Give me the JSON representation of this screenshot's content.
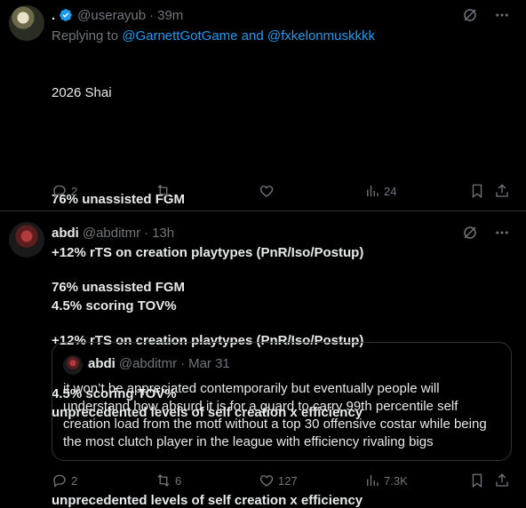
{
  "tweets": [
    {
      "name": ".",
      "handle": "@userayub",
      "time": "39m",
      "reply_prefix": "Replying to",
      "reply_user1": "@GarnettGotGame",
      "reply_and": "and",
      "reply_user2": "@fxkelonmuskkkk",
      "lines": [
        "2026 Shai",
        "",
        "76% unassisted FGM",
        "+12% rTS on creation playtypes (PnR/Iso/Postup)",
        "4.5% scoring TOV%",
        "",
        "unprecedented levels of self creation x efficiency"
      ],
      "actions": {
        "replies": "2",
        "retweets": "",
        "likes": "",
        "views": "24"
      }
    },
    {
      "name": "abdi",
      "handle": "@abditmr",
      "time": "13h",
      "lines": [
        "76% unassisted FGM",
        "+12% rTS on creation playtypes (PnR/Iso/Postup)",
        "4.5% scoring TOV%",
        "",
        "unprecedented levels of self creation x efficiency"
      ],
      "quote": {
        "name": "abdi",
        "handle": "@abditmr",
        "date": "Mar 31",
        "lines": [
          "it won’t be appreciated contemporarily but eventually people will",
          "understand how absurd it is for a guard to carry 99th percentile self",
          "creation load from the motf without a top 30 offensive costar while being",
          "the most clutch player in the league with efficiency rivaling bigs"
        ]
      },
      "actions": {
        "replies": "2",
        "retweets": "6",
        "likes": "127",
        "views": "7.3K"
      }
    }
  ],
  "icons": {
    "verified": "verified-badge-icon",
    "grok": "grok-icon",
    "more": "more-icon",
    "reply": "reply-icon",
    "retweet": "retweet-icon",
    "like": "like-icon",
    "views": "views-icon",
    "bookmark": "bookmark-icon",
    "share": "share-icon"
  },
  "colors": {
    "background": "#000000",
    "text": "#e7e9ea",
    "muted": "#71767b",
    "link": "#1d9bf0",
    "border": "#2f3336"
  }
}
